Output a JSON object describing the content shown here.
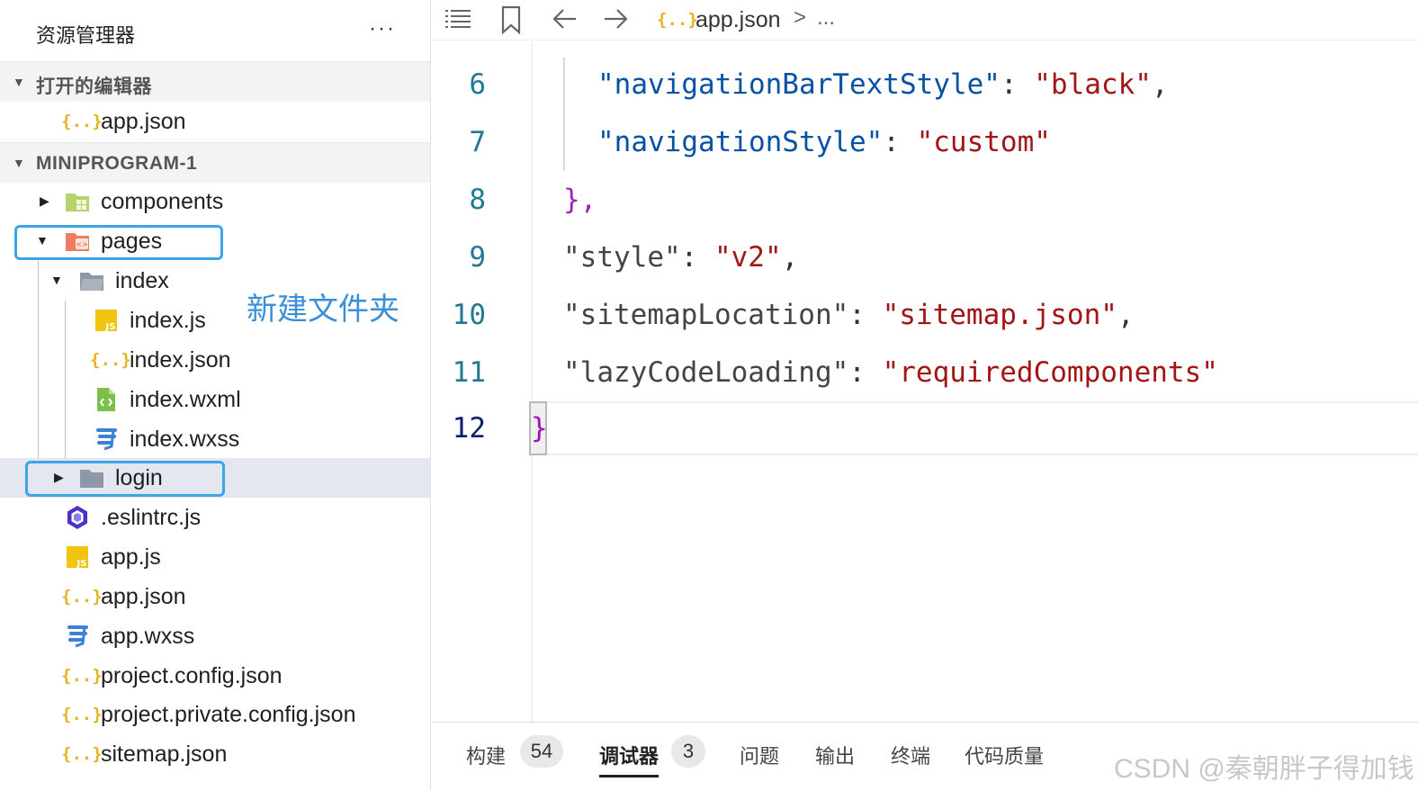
{
  "sidebar": {
    "title": "资源管理器",
    "more": "···",
    "open_editors": {
      "label": "打开的编辑器",
      "items": [
        {
          "name": "app.json"
        }
      ]
    },
    "project": {
      "label": "MINIPROGRAM-1",
      "items": [
        {
          "name": "components"
        },
        {
          "name": "pages"
        },
        {
          "name": "index"
        },
        {
          "name": "index.js"
        },
        {
          "name": "index.json"
        },
        {
          "name": "index.wxml"
        },
        {
          "name": "index.wxss"
        },
        {
          "name": "login"
        },
        {
          "name": ".eslintrc.js"
        },
        {
          "name": "app.js"
        },
        {
          "name": "app.json"
        },
        {
          "name": "app.wxss"
        },
        {
          "name": "project.config.json"
        },
        {
          "name": "project.private.config.json"
        },
        {
          "name": "sitemap.json"
        }
      ]
    },
    "annotation": "新建文件夹",
    "json_icon_text": "{..}",
    "js_icon_text": "JS"
  },
  "toolbar": {
    "breadcrumb_file": "app.json",
    "breadcrumb_sep": ">",
    "breadcrumb_more": "..."
  },
  "editor": {
    "lines": [
      {
        "num": "6",
        "key": "\"navigationBarTextStyle\"",
        "sep": ": ",
        "val": "\"black\"",
        "tail": ","
      },
      {
        "num": "7",
        "key": "\"navigationStyle\"",
        "sep": ": ",
        "val": "\"custom\"",
        "tail": ""
      },
      {
        "num": "8",
        "text": "},"
      },
      {
        "num": "9",
        "key": "\"style\"",
        "sep": ": ",
        "val": "\"v2\"",
        "tail": ","
      },
      {
        "num": "10",
        "key": "\"sitemapLocation\"",
        "sep": ": ",
        "val": "\"sitemap.json\"",
        "tail": ","
      },
      {
        "num": "11",
        "key": "\"lazyCodeLoading\"",
        "sep": ": ",
        "val": "\"requiredComponents\"",
        "tail": ""
      },
      {
        "num": "12",
        "text": "}"
      }
    ]
  },
  "panel": {
    "tabs": [
      {
        "label": "构建",
        "badge": "54"
      },
      {
        "label": "调试器",
        "badge": "3"
      },
      {
        "label": "问题"
      },
      {
        "label": "输出"
      },
      {
        "label": "终端"
      },
      {
        "label": "代码质量"
      }
    ],
    "active_tab": "调试器"
  },
  "watermark": "CSDN @秦朝胖子得加钱",
  "colors": {
    "annotation_blue": "#3ba5ea",
    "json_key": "#0451a5",
    "json_string": "#a31515",
    "brace": "#9c27b0"
  }
}
